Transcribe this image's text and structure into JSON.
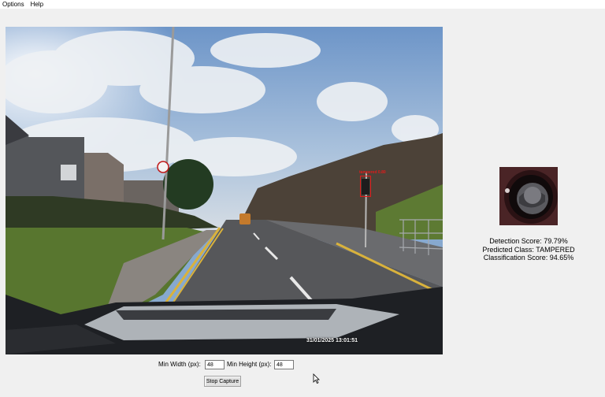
{
  "menu": {
    "options": "Options",
    "help": "Help"
  },
  "video": {
    "timestamp": "31/01/2025 13:01:51",
    "detection_label": "tampered 0.80"
  },
  "results": {
    "detection_score": "Detection Score: 79.79%",
    "predicted_class": "Predicted Class: TAMPERED",
    "classification_score": "Classification Score: 94.65%"
  },
  "controls": {
    "min_width_label": "Min Width (px):",
    "min_width_value": "48",
    "min_height_label": "Min Height (px):",
    "min_height_value": "48",
    "stop_button": "Stop Capture"
  },
  "colors": {
    "detection_box": "#e11b1b",
    "window_bg": "#f0f0f0"
  }
}
